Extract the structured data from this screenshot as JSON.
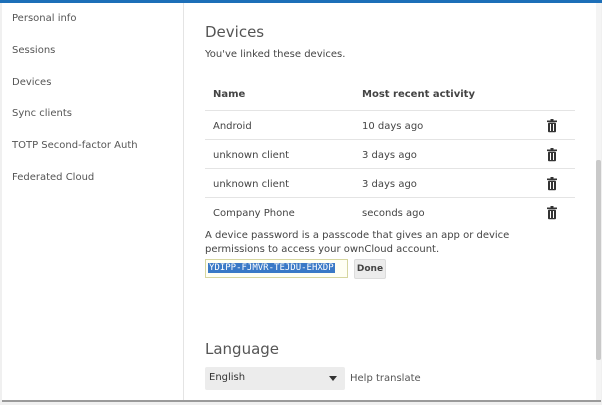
{
  "sidebar": {
    "items": [
      {
        "label": "Personal info"
      },
      {
        "label": "Sessions"
      },
      {
        "label": "Devices"
      },
      {
        "label": "Sync clients"
      },
      {
        "label": "TOTP Second-factor Auth"
      },
      {
        "label": "Federated Cloud"
      }
    ]
  },
  "devices": {
    "title": "Devices",
    "subtitle": "You've linked these devices.",
    "columns": {
      "name": "Name",
      "activity": "Most recent activity"
    },
    "rows": [
      {
        "name": "Android",
        "activity": "10 days ago"
      },
      {
        "name": "unknown client",
        "activity": "3 days ago"
      },
      {
        "name": "unknown client",
        "activity": "3 days ago"
      },
      {
        "name": "Company Phone",
        "activity": "seconds ago"
      }
    ],
    "note": "A device password is a passcode that gives an app or device permissions to access your ownCloud account.",
    "password_value": "YDIPP-FJMVR-TEJDU-EHXDP",
    "done_label": "Done"
  },
  "language": {
    "title": "Language",
    "selected": "English",
    "help_link": "Help translate"
  },
  "icons": {
    "trash": "trash-icon",
    "caret": "chevron-down-icon"
  },
  "colors": {
    "accent": "#1d6fb8",
    "selection": "#3a79c6"
  }
}
